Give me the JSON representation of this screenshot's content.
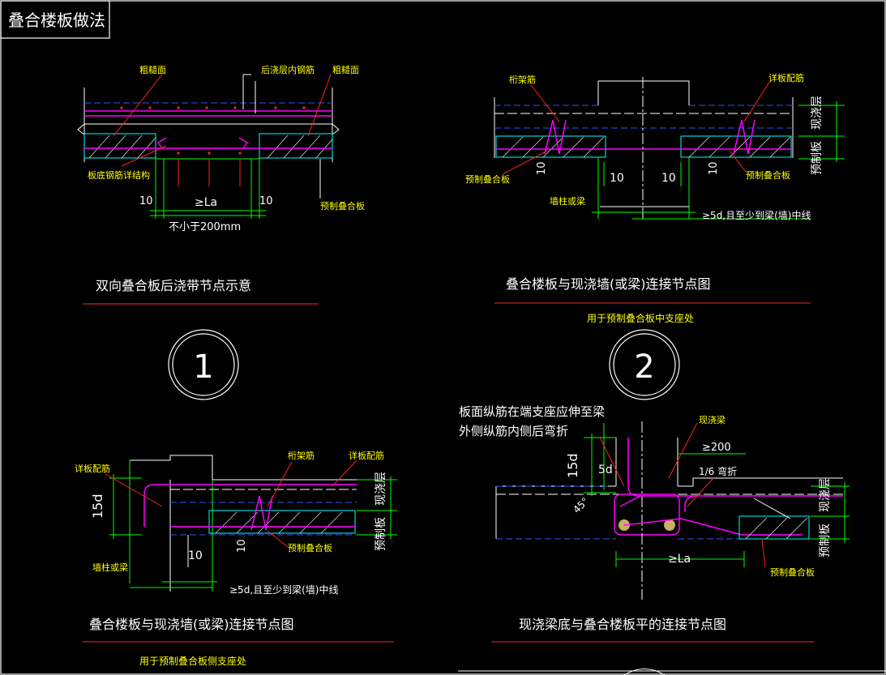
{
  "sheet": {
    "title": "叠合楼板做法"
  },
  "detail1": {
    "caption": "双向叠合板后浇带节点示意",
    "number": "1",
    "labels": {
      "rough_left": "粗糙面",
      "rough_right": "粗糙面",
      "cast_rebar": "后浇层内钢筋",
      "bottom_rebar": "板底钢筋详结构",
      "precast": "预制叠合板"
    },
    "dims": {
      "d10_left": "10",
      "la": "≥La",
      "d10_right": "10",
      "min200": "不小于200mm"
    }
  },
  "detail2": {
    "caption": "叠合楼板与现浇墙(或梁)连接节点图",
    "subcaption": "用于预制叠合板中支座处",
    "number": "2",
    "labels": {
      "truss": "桁架筋",
      "panel_rebar": "详板配筋",
      "precast_left": "预制叠合板",
      "precast_right": "预制叠合板",
      "wall": "墙柱或梁",
      "cast_layer": "现浇层",
      "precast_layer": "预制板",
      "anchor": "≥5d,且至少到梁(墙)中线"
    },
    "dims": {
      "d10_a": "10",
      "d10_b": "10",
      "d10_c": "10",
      "d10_d": "10"
    }
  },
  "detail3": {
    "caption": "叠合楼板与现浇墙(或梁)连接节点图",
    "subcaption": "用于预制叠合板侧支座处",
    "labels": {
      "panel_rebar_left": "详板配筋",
      "truss": "桁架筋",
      "panel_rebar_right": "详板配筋",
      "wall": "墙柱或梁",
      "precast": "预制叠合板",
      "cast_layer": "现浇层",
      "precast_layer": "预制板",
      "anchor": "≥5d,且至少到梁(墙)中线"
    },
    "dims": {
      "d15": "15d",
      "d10_a": "10",
      "d10_b": "10"
    }
  },
  "detail4": {
    "caption": "现浇梁底与叠合楼板平的连接节点图",
    "note_line1": "板面纵筋在端支座应伸至梁",
    "note_line2": "外侧纵筋内侧后弯折",
    "labels": {
      "cast_beam": "现浇梁",
      "ge200": "≥200",
      "sixth_bend": "1/6 弯折",
      "cast_layer": "现浇层",
      "precast_layer": "预制板",
      "precast": "预制叠合板"
    },
    "dims": {
      "d15": "15d",
      "d5": "5d",
      "angle": "45°",
      "la": "≥La"
    }
  },
  "colors": {
    "background": "#000000",
    "white": "#ffffff",
    "yellow": "#ffff00",
    "green": "#00ff00",
    "blue": "#3050ff",
    "magenta": "#ff00ff",
    "red": "#ff2020",
    "cyan": "#00ffff"
  }
}
